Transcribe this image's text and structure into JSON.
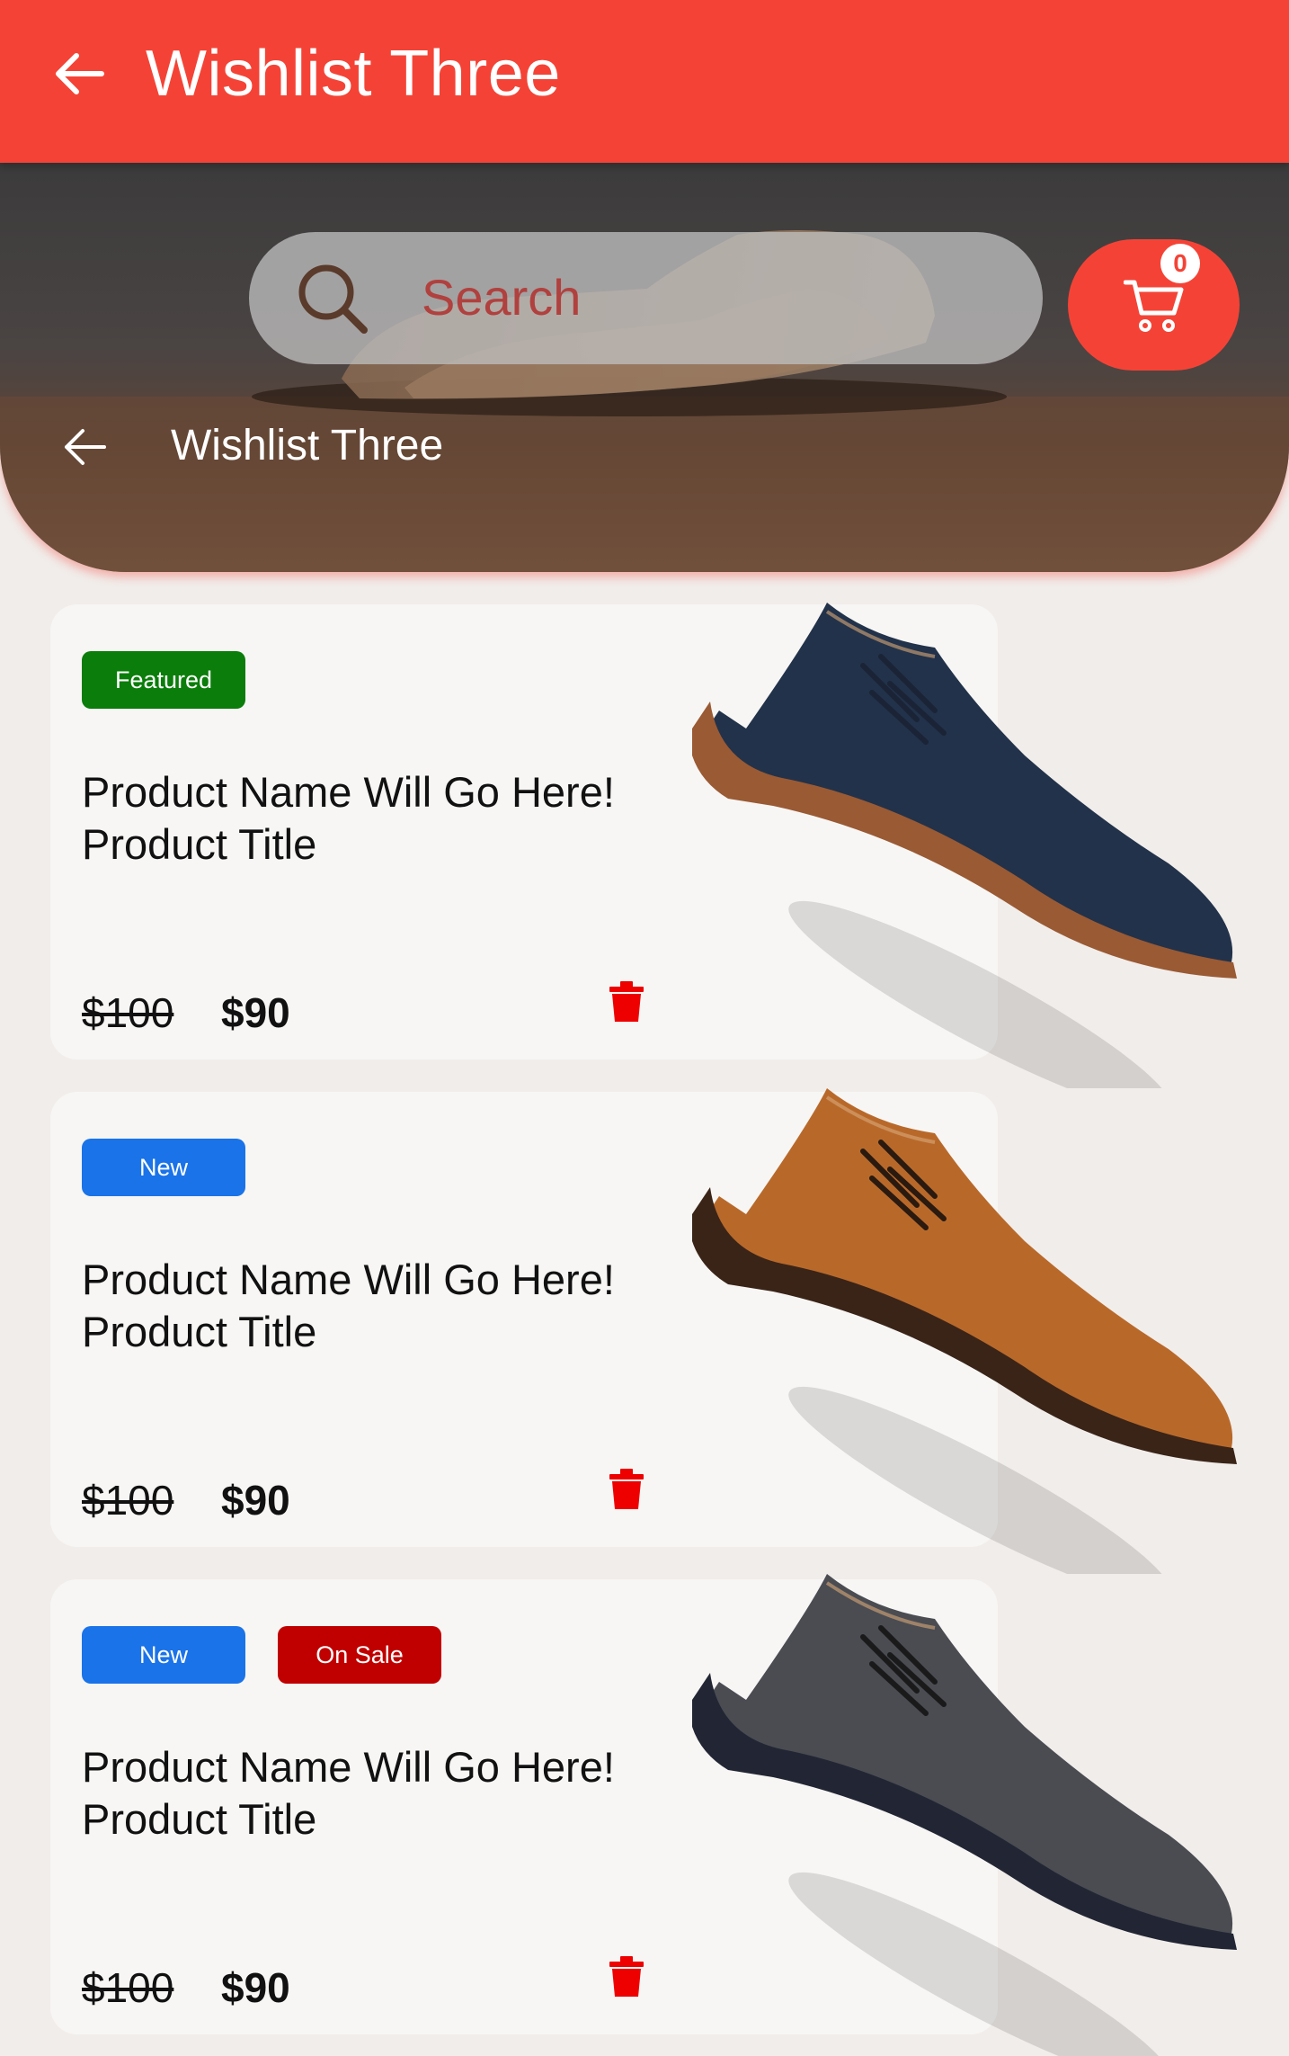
{
  "appbar": {
    "title": "Wishlist Three"
  },
  "search": {
    "placeholder": "Search"
  },
  "cart": {
    "count": "0"
  },
  "hero": {
    "title": "Wishlist Three"
  },
  "products": [
    {
      "badges": [
        {
          "label": "Featured",
          "color": "#0a7d0a"
        }
      ],
      "name": "Product Name Will Go Here! Product Title",
      "old_price": "$100",
      "price": "$90"
    },
    {
      "badges": [
        {
          "label": "New",
          "color": "#1a73e8"
        }
      ],
      "name": "Product Name Will Go Here! Product Title",
      "old_price": "$100",
      "price": "$90"
    },
    {
      "badges": [
        {
          "label": "New",
          "color": "#1a73e8"
        },
        {
          "label": "On Sale",
          "color": "#c00000"
        }
      ],
      "name": "Product Name Will Go Here! Product Title",
      "old_price": "$100",
      "price": "$90"
    }
  ],
  "colors": {
    "accent": "#f44336",
    "trash": "#ee0000"
  },
  "icons": [
    "arrow-back-icon",
    "search-icon",
    "cart-icon",
    "trash-icon"
  ]
}
